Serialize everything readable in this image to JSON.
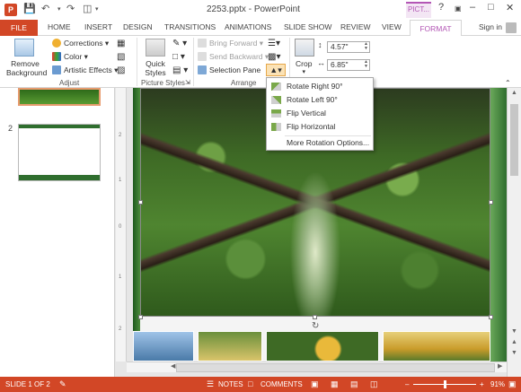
{
  "window": {
    "title": "2253.pptx - PowerPoint",
    "app_icon": "P",
    "picture_tools_tab": "PICT...",
    "help": "?",
    "controls": [
      "–",
      "□",
      "✕"
    ]
  },
  "qat": {
    "save_icon": "save-icon",
    "undo_icon": "undo-icon",
    "redo_icon": "redo-icon",
    "customize_icon": "slideshow-icon"
  },
  "tabs": [
    "HOME",
    "INSERT",
    "DESIGN",
    "TRANSITIONS",
    "ANIMATIONS",
    "SLIDE SHOW",
    "REVIEW",
    "VIEW"
  ],
  "file_tab": "FILE",
  "active_tab": "FORMAT",
  "sign_in": "Sign in",
  "ribbon": {
    "adjust": {
      "label": "Adjust",
      "remove_background": [
        "Remove",
        "Background"
      ],
      "corrections": "Corrections",
      "color": "Color",
      "artistic_effects": "Artistic Effects"
    },
    "picture_styles": {
      "label": "Picture Styles",
      "quick_styles": [
        "Quick",
        "Styles"
      ]
    },
    "arrange": {
      "label": "Arrange",
      "bring_forward": "Bring Forward",
      "send_backward": "Send Backward",
      "selection_pane": "Selection Pane"
    },
    "size": {
      "crop": "Crop",
      "height": "4.57\"",
      "width": "6.85\""
    }
  },
  "rotate_menu": {
    "items": [
      "Rotate Right 90°",
      "Rotate Left 90°",
      "Flip Vertical",
      "Flip Horizontal",
      "More Rotation Options..."
    ]
  },
  "thumbnails": {
    "slide2_number": "2"
  },
  "ruler_v": [
    "2",
    "1",
    "0",
    "1",
    "2"
  ],
  "status": {
    "slide": "SLIDE 1 OF 2",
    "notes": "NOTES",
    "comments": "COMMENTS",
    "zoom_minus": "–",
    "zoom_plus": "+",
    "zoom": "91%"
  },
  "colors": {
    "accent": "#d24726",
    "format": "#b356b5"
  }
}
